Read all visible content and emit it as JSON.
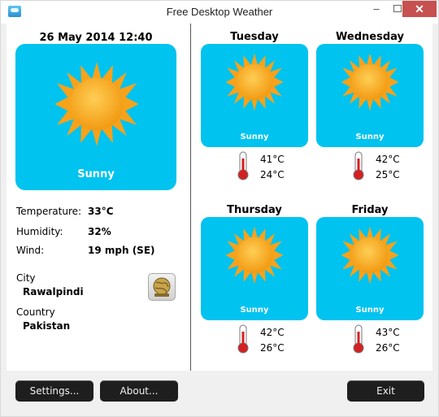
{
  "window": {
    "title": "Free Desktop Weather",
    "minimize": "–",
    "close": "✕"
  },
  "current": {
    "datetime": "26 May 2014 12:40",
    "condition": "Sunny",
    "temperature_label": "Temperature:",
    "temperature": "33°C",
    "humidity_label": "Humidity:",
    "humidity": "32%",
    "wind_label": "Wind:",
    "wind": "19 mph (SE)",
    "city_label": "City",
    "city": "Rawalpindi",
    "country_label": "Country",
    "country": "Pakistan"
  },
  "forecast": [
    {
      "day": "Tuesday",
      "condition": "Sunny",
      "high": "41°C",
      "low": "24°C"
    },
    {
      "day": "Wednesday",
      "condition": "Sunny",
      "high": "42°C",
      "low": "25°C"
    },
    {
      "day": "Thursday",
      "condition": "Sunny",
      "high": "42°C",
      "low": "26°C"
    },
    {
      "day": "Friday",
      "condition": "Sunny",
      "high": "43°C",
      "low": "26°C"
    }
  ],
  "buttons": {
    "settings": "Settings...",
    "about": "About...",
    "exit": "Exit"
  },
  "icons": {
    "weather": "sun-icon",
    "thermometer": "thermometer-icon",
    "location": "globe-map-icon"
  },
  "colors": {
    "card": "#00c3ef",
    "sun": "#f7a21b",
    "button": "#1e1e1e",
    "close": "#c75050"
  }
}
